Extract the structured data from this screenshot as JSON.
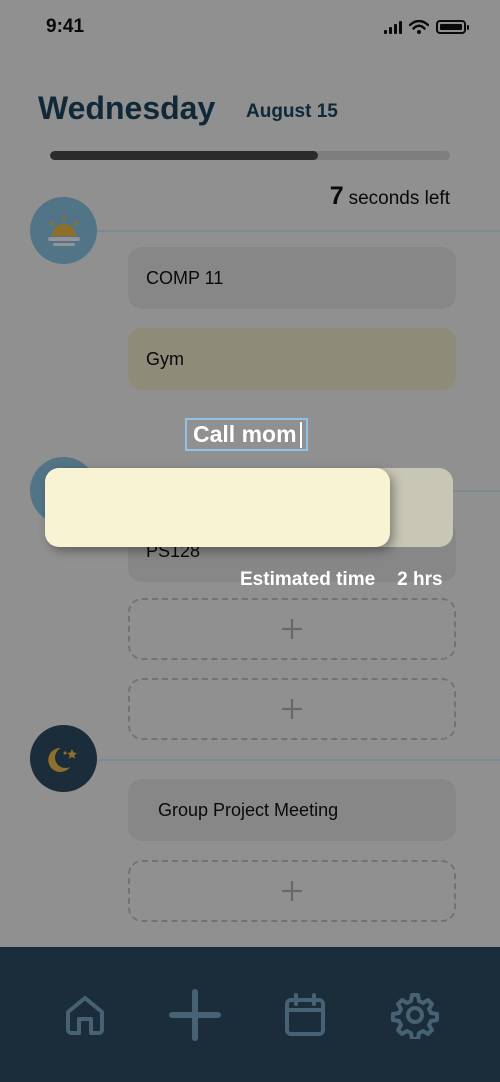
{
  "status_bar": {
    "time": "9:41"
  },
  "header": {
    "day": "Wednesday",
    "date": "August 15",
    "progress": 0.67,
    "time_left_value": "7",
    "time_left_label": "seconds left"
  },
  "sections": [
    {
      "icon": "sunrise-icon",
      "color": "#8ec9e8"
    },
    {
      "icon": "moon-stars-icon",
      "color": "#2f4f66"
    }
  ],
  "tasks": {
    "morning": [
      {
        "label": "COMP 11"
      },
      {
        "label": "Gym"
      }
    ],
    "afternoon_partial": "PS128",
    "evening": [
      {
        "label": "Group Project Meeting"
      }
    ]
  },
  "add_slot_icon": "plus-icon",
  "editor": {
    "title": "Call mom",
    "estimate_label": "Estimated time",
    "estimate_value": "2 hrs"
  },
  "nav": [
    {
      "name": "home",
      "icon": "home-icon"
    },
    {
      "name": "add",
      "icon": "plus-icon"
    },
    {
      "name": "calendar",
      "icon": "calendar-icon"
    },
    {
      "name": "settings",
      "icon": "gear-icon"
    }
  ],
  "colors": {
    "accent": "#1d4661",
    "gym_card": "#f5f0cf",
    "nav_bg": "#2f4f66",
    "sun": "#f3c24a"
  }
}
